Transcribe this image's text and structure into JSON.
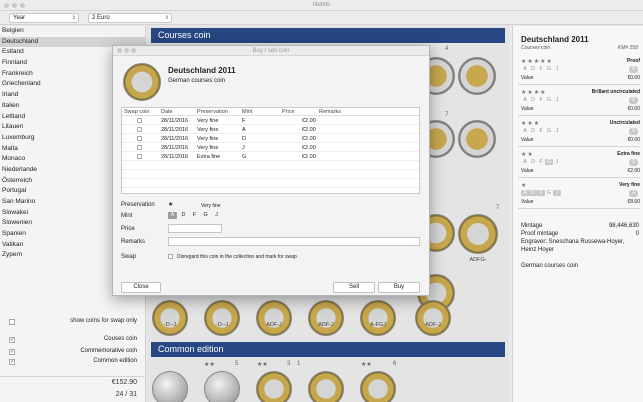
{
  "window": {
    "title": "Numis"
  },
  "toolbar": {
    "year_select": "Year",
    "denomination_select": "2 Euro"
  },
  "sidebar": {
    "countries": [
      "Belgien",
      "Deutschland",
      "Estland",
      "Finnland",
      "Frankreich",
      "Griechenland",
      "Irland",
      "Italien",
      "Lettland",
      "Litauen",
      "Luxemburg",
      "Malta",
      "Monaco",
      "Niederlande",
      "Österreich",
      "Portugal",
      "San Marino",
      "Slowakei",
      "Slowenien",
      "Spanien",
      "Vatikan",
      "Zypern"
    ],
    "selected_index": 1,
    "options": [
      {
        "label": "show coins for swap only",
        "checked": false
      },
      {
        "label": "Couses coin",
        "checked": true
      },
      {
        "label": "Commemorative coin",
        "checked": true
      },
      {
        "label": "Common edition",
        "checked": true
      }
    ],
    "total_value": "€152.90",
    "count": "24 / 31"
  },
  "main": {
    "sections": [
      "Courses coin",
      "Common edition"
    ],
    "numbers_top": [
      "4",
      "7",
      "7"
    ],
    "coin_labels": [
      "ADFG-",
      "-D--J",
      "-D--J",
      "ADF-J",
      "ADF-J",
      "A-FGJ",
      "ADF-J"
    ],
    "bottom_stars": [
      "★★",
      "★★",
      "★★"
    ],
    "bottom_numbers": [
      "5",
      "3",
      "1",
      "6"
    ]
  },
  "dialog": {
    "title": "Buy / sell coin",
    "coin_name": "Deutschland 2011",
    "coin_subtitle": "German courses coin",
    "table_headers": [
      "Swap coin",
      "Date",
      "Preservation",
      "Mint",
      "Price",
      "Remarks"
    ],
    "rows": [
      {
        "date": "28/11/2016",
        "preservation": "Very fine",
        "mint": "F",
        "price": "€2.00"
      },
      {
        "date": "28/11/2016",
        "preservation": "Very fine",
        "mint": "A",
        "price": "€2.00"
      },
      {
        "date": "28/11/2016",
        "preservation": "Very fine",
        "mint": "D",
        "price": "€2.00"
      },
      {
        "date": "28/11/2016",
        "preservation": "Very fine",
        "mint": "J",
        "price": "€2.00"
      },
      {
        "date": "28/11/2016",
        "preservation": "Extra fine",
        "mint": "G",
        "price": "€2.00"
      }
    ],
    "preservation_label": "Preservation",
    "preservation_star": "★",
    "preservation_value": "Very fine",
    "mint_label": "Mint",
    "mint_options": [
      "A",
      "D",
      "F",
      "G",
      "J"
    ],
    "mint_selected": "A",
    "price_label": "Price",
    "remarks_label": "Remarks",
    "swap_label": "Swap",
    "swap_text": "Disregard this coin in the collection and mark for swap",
    "close_button": "Close",
    "sell_button": "Sell",
    "buy_button": "Buy"
  },
  "right_panel": {
    "title": "Deutschland 2011",
    "subtitle": "Courses coin",
    "km": "KM# 258",
    "grades": [
      {
        "stars": "★★★★★",
        "name": "Proof",
        "mints": [
          "A",
          "D",
          "F",
          "G",
          "J"
        ],
        "boxed": [],
        "count": "0",
        "value_label": "Value",
        "value": "€0.00"
      },
      {
        "stars": "★★★★",
        "name": "Brillant uncirculated",
        "mints": [
          "A",
          "D",
          "F",
          "G",
          "J"
        ],
        "boxed": [],
        "count": "0",
        "value_label": "Value",
        "value": "€0.00"
      },
      {
        "stars": "★★★",
        "name": "Uncirculated",
        "mints": [
          "A",
          "D",
          "F",
          "G",
          "J"
        ],
        "boxed": [],
        "count": "0",
        "value_label": "Value",
        "value": "€0.00"
      },
      {
        "stars": "★★",
        "name": "Extra fine",
        "mints": [
          "A",
          "D",
          "F",
          "G",
          "J"
        ],
        "boxed": [
          "G"
        ],
        "count": "1",
        "value_label": "Value",
        "value": "€2.00"
      },
      {
        "stars": "★",
        "name": "Very fine",
        "mints": [
          "A",
          "D",
          "F",
          "G",
          "J"
        ],
        "boxed": [
          "A",
          "D",
          "F",
          "J"
        ],
        "count": "4",
        "value_label": "Value",
        "value": "€8.00"
      }
    ],
    "mintage_label": "Mintage",
    "mintage_value": "98,446,630",
    "proof_label": "Proof mintage",
    "proof_value": "0",
    "engraver": "Engraver: Sneschana Russewa-Hoyer, Heinz Hoyer",
    "description": "German courses coin"
  }
}
